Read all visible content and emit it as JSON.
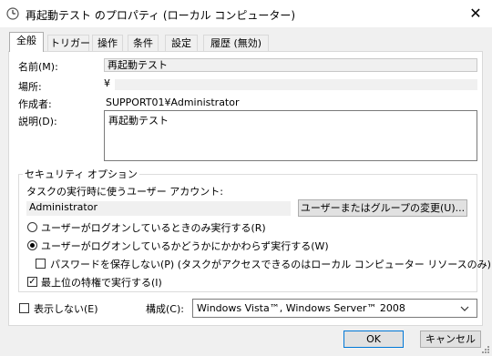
{
  "window": {
    "title": "再起動テスト のプロパティ (ローカル コンピューター)",
    "close_glyph": "✕",
    "icon": "clock-icon"
  },
  "tabs": [
    {
      "label": "全般",
      "active": true
    },
    {
      "label": "トリガー",
      "active": false
    },
    {
      "label": "操作",
      "active": false
    },
    {
      "label": "条件",
      "active": false
    },
    {
      "label": "設定",
      "active": false
    },
    {
      "label": "履歴 (無効)",
      "active": false
    }
  ],
  "general": {
    "name_label": "名前(M):",
    "name_value": "再起動テスト",
    "location_label": "場所:",
    "location_value": "¥",
    "author_label": "作成者:",
    "author_value": "SUPPORT01¥Administrator",
    "description_label": "説明(D):",
    "description_value": "再起動テスト"
  },
  "security": {
    "title": "セキュリティ オプション",
    "account_prompt": "タスクの実行時に使うユーザー アカウント:",
    "account_value": "Administrator",
    "change_user_button": "ユーザーまたはグループの変更(U)...",
    "radio_logon_only": {
      "label": "ユーザーがログオンしているときのみ実行する(R)",
      "selected": false
    },
    "radio_whether_logged": {
      "label": "ユーザーがログオンしているかどうかにかかわらず実行する(W)",
      "selected": true
    },
    "no_store_password": {
      "label": "パスワードを保存しない(P) (タスクがアクセスできるのはローカル コンピューター リソースのみ)",
      "checked": false
    },
    "highest_privileges": {
      "label": "最上位の特権で実行する(I)",
      "checked": true
    }
  },
  "footer": {
    "hidden_label": "表示しない(E)",
    "hidden_checked": false,
    "configure_label": "構成(C):",
    "configure_value": "Windows Vista™, Windows Server™ 2008",
    "ok_label": "OK",
    "cancel_label": "キャンセル"
  }
}
